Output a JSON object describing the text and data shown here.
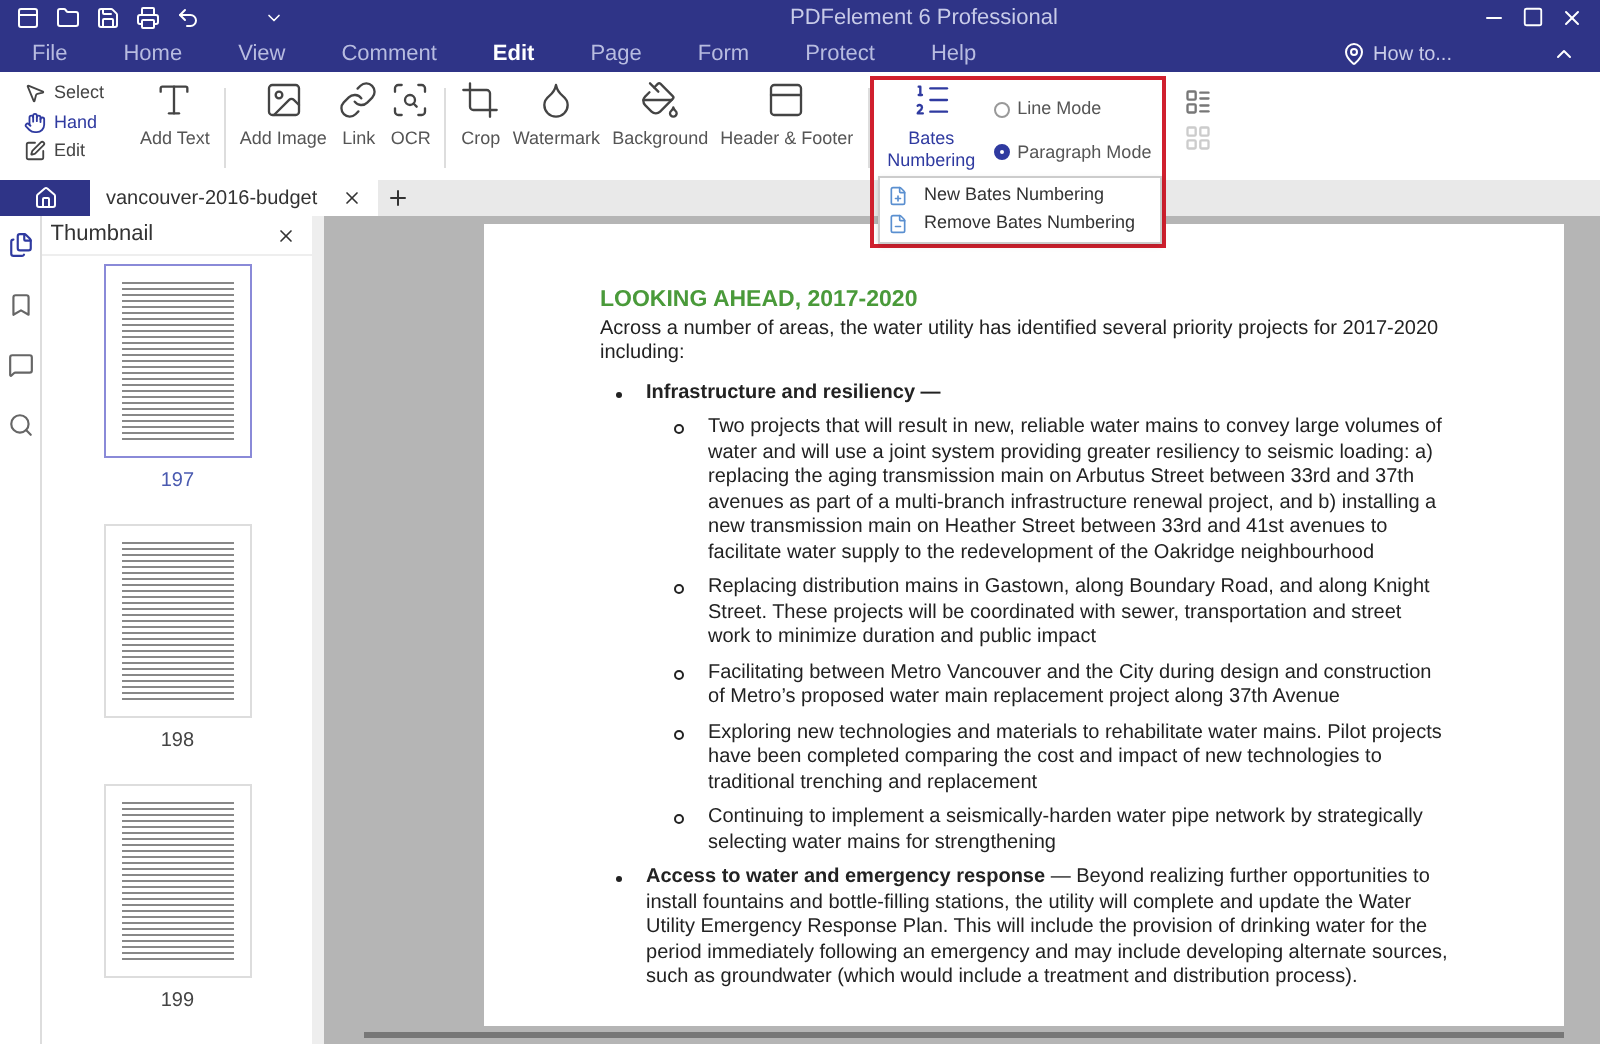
{
  "window": {
    "title": "PDFelement 6 Professional"
  },
  "menu": [
    {
      "label": "File",
      "selected": false
    },
    {
      "label": "Home",
      "selected": false
    },
    {
      "label": "View",
      "selected": false
    },
    {
      "label": "Comment",
      "selected": false
    },
    {
      "label": "Edit",
      "selected": true
    },
    {
      "label": "Page",
      "selected": false
    },
    {
      "label": "Form",
      "selected": false
    },
    {
      "label": "Protect",
      "selected": false
    },
    {
      "label": "Help",
      "selected": false
    }
  ],
  "help_link": "How to...",
  "ribbon": {
    "modes": [
      {
        "label": "Select",
        "kind": "select",
        "selected": false
      },
      {
        "label": "Hand",
        "kind": "hand",
        "selected": true
      },
      {
        "label": "Edit",
        "kind": "edit",
        "selected": false
      }
    ],
    "tools": [
      {
        "label": "Add Text",
        "kind": "text",
        "selected": false
      },
      {
        "label": "Add Image",
        "kind": "image",
        "selected": false
      },
      {
        "label": "Link",
        "kind": "link",
        "selected": false
      },
      {
        "label": "OCR",
        "kind": "ocr",
        "selected": false
      },
      {
        "label": "Crop",
        "kind": "crop",
        "selected": false
      },
      {
        "label": "Watermark",
        "kind": "watermark",
        "selected": false
      },
      {
        "label": "Background",
        "kind": "background",
        "selected": false
      },
      {
        "label": "Header & Footer",
        "kind": "header",
        "selected": false
      },
      {
        "label": "Bates Numbering",
        "kind": "bates",
        "selected": true
      }
    ],
    "text_modes": [
      {
        "label": "Line Mode",
        "selected": false
      },
      {
        "label": "Paragraph Mode",
        "selected": true
      }
    ],
    "dropdown": [
      {
        "label": "New Bates Numbering",
        "kind": "new"
      },
      {
        "label": "Remove Bates Numbering",
        "kind": "remove"
      }
    ]
  },
  "document_tab": {
    "title": "vancouver-2016-budget"
  },
  "thumbnail_panel": {
    "title": "Thumbnail",
    "pages": [
      {
        "label": "197",
        "selected": true
      },
      {
        "label": "198",
        "selected": false
      },
      {
        "label": "199",
        "selected": false
      }
    ]
  },
  "document": {
    "heading": "LOOKING AHEAD, 2017-2020",
    "intro": "Across a number of areas, the water utility has identified several priority projects for 2017-2020 including:",
    "bullets": [
      {
        "title": "Infrastructure and resiliency —",
        "children": [
          "Two projects that will result in new, reliable water mains to convey large volumes of water and will use a joint system providing greater resiliency to seismic loading: a) replacing the aging transmission main on Arbutus Street between 33rd and 37th avenues as part of a multi-branch infrastructure renewal project, and b) installing a new transmission main on Heather Street between 33rd and 41st avenues to facilitate water supply to the redevelopment of the Oakridge neighbourhood",
          "Replacing distribution mains in Gastown, along Boundary Road, and along Knight Street. These projects will be coordinated with sewer, transportation and street work to minimize duration and public impact",
          "Facilitating between Metro Vancouver and the City during design and construction of Metro’s proposed water main replacement project along 37th Avenue",
          "Exploring new technologies and materials to rehabilitate water mains. Pilot projects have been completed comparing the cost and impact of new technologies to traditional trenching and replacement",
          "Continuing to implement a seismically-harden water pipe network by strategically selecting water mains for strengthening"
        ]
      },
      {
        "title": "Access to water and emergency response",
        "text": " — Beyond realizing further opportunities to install fountains and bottle-filling stations, the utility will complete and update the Water Utility Emergency Response Plan. This will include the provision of drinking water for the period immediately following an emergency and may include developing alternate sources, such as groundwater (which would include a treatment and distribution process)."
      }
    ]
  }
}
